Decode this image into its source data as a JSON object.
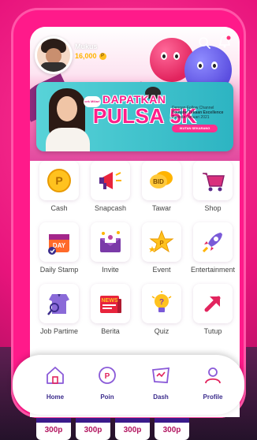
{
  "user": {
    "name": "Mukus",
    "points": "16,000"
  },
  "banner": {
    "bubble": "cek Miliar!",
    "title_line1": "DAPATKAN",
    "title_line2": "PULSA 5K",
    "info_line1": "Dengan Follow Channel",
    "info_line2": "Youtube Tukaan Excellence",
    "info_line3": "Periode Januari 2021",
    "button": "IKUTAN SEKARANG"
  },
  "menu": [
    {
      "label": "Cash",
      "icon": "coin-icon"
    },
    {
      "label": "Snapcash",
      "icon": "megaphone-icon"
    },
    {
      "label": "Tawar",
      "icon": "bid-icon"
    },
    {
      "label": "Shop",
      "icon": "cart-icon"
    },
    {
      "label": "Daily Stamp",
      "icon": "calendar-icon"
    },
    {
      "label": "Invite",
      "icon": "envelope-icon"
    },
    {
      "label": "Event",
      "icon": "stars-icon"
    },
    {
      "label": "Entertainment",
      "icon": "rocket-icon"
    },
    {
      "label": "Job Partime",
      "icon": "shirt-search-icon"
    },
    {
      "label": "Berita",
      "icon": "news-icon"
    },
    {
      "label": "Quiz",
      "icon": "bulb-icon"
    },
    {
      "label": "Tutup",
      "icon": "arrow-up-right-icon"
    }
  ],
  "nav": [
    {
      "label": "Home",
      "icon": "home-icon"
    },
    {
      "label": "Poin",
      "icon": "poin-icon"
    },
    {
      "label": "Dash",
      "icon": "dash-icon"
    },
    {
      "label": "Profile",
      "icon": "profile-icon"
    }
  ],
  "price_tabs": [
    "300p",
    "300p",
    "300p",
    "300p"
  ],
  "colors": {
    "brand_pink": "#e8147c",
    "nav_text": "#3b2c8c",
    "price_text": "#b2145f"
  }
}
